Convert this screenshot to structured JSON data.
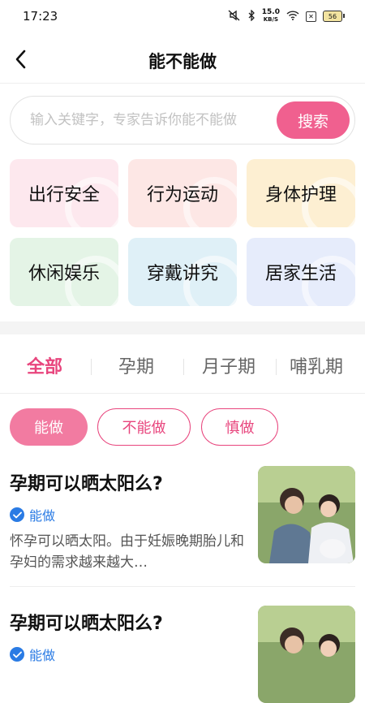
{
  "status": {
    "time": "17:23",
    "netspeed_value": "15.0",
    "netspeed_unit": "KB/S",
    "battery": "56"
  },
  "nav": {
    "title": "能不能做"
  },
  "search": {
    "placeholder": "输入关键字，专家告诉你能不能做",
    "button": "搜索"
  },
  "categories": [
    {
      "label": "出行安全",
      "bg": "#fde8ee"
    },
    {
      "label": "行为运动",
      "bg": "#fde7e5"
    },
    {
      "label": "身体护理",
      "bg": "#fdefd2"
    },
    {
      "label": "休闲娱乐",
      "bg": "#e4f4e6"
    },
    {
      "label": "穿戴讲究",
      "bg": "#dff0f7"
    },
    {
      "label": "居家生活",
      "bg": "#e6ecfb"
    }
  ],
  "tabs": [
    {
      "label": "全部"
    },
    {
      "label": "孕期"
    },
    {
      "label": "月子期"
    },
    {
      "label": "哺乳期"
    }
  ],
  "filters": [
    {
      "label": "能做"
    },
    {
      "label": "不能做"
    },
    {
      "label": "慎做"
    }
  ],
  "articles": [
    {
      "title": "孕期可以晒太阳么?",
      "tag": "能做",
      "desc": "怀孕可以晒太阳。由于妊娠晚期胎儿和孕妇的需求越来越大…"
    },
    {
      "title": "孕期可以晒太阳么?",
      "tag": "能做",
      "desc": ""
    }
  ],
  "colors": {
    "accent": "#e8457d",
    "button": "#f0608f",
    "tag_blue": "#2a7be4"
  }
}
